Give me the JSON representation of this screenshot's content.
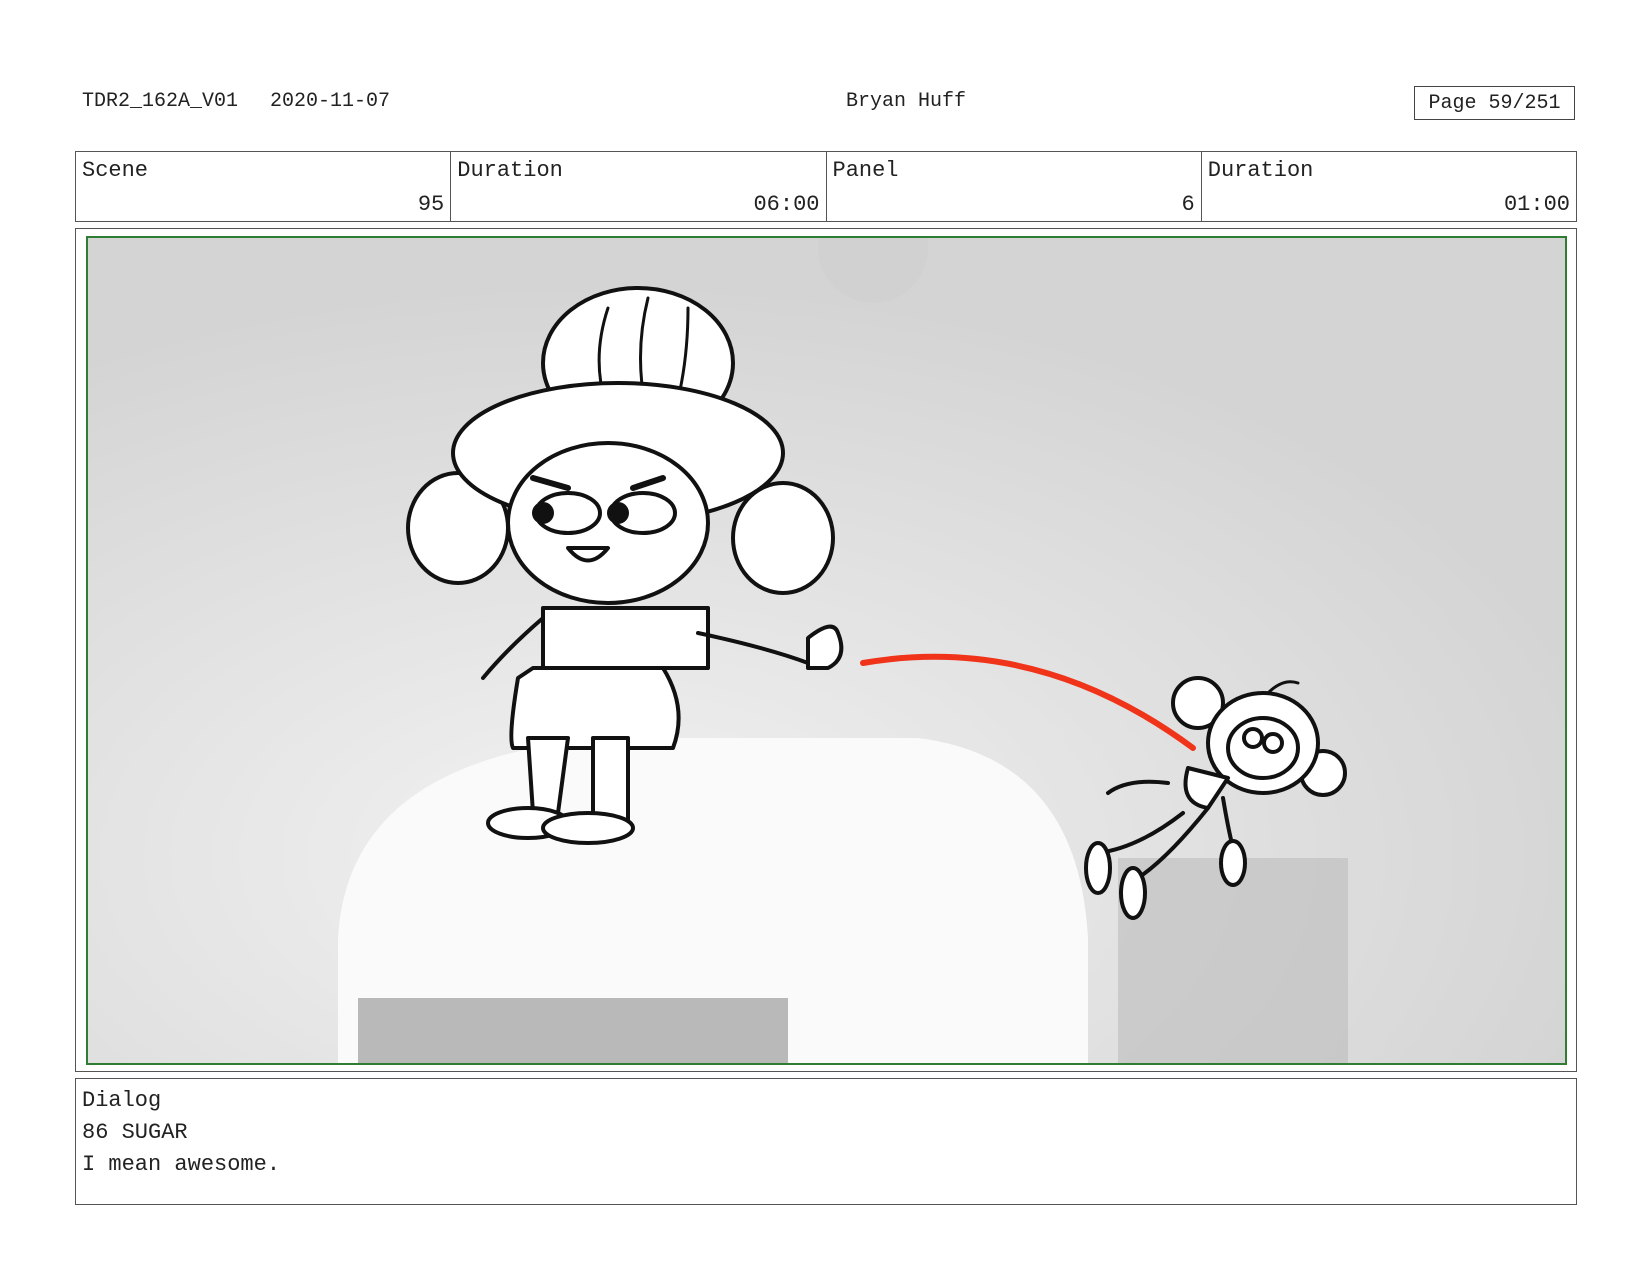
{
  "header": {
    "production_id": "TDR2_162A_V01",
    "date": "2020-11-07",
    "author": "Bryan Huff",
    "page_label": "Page",
    "page_number": "59/251"
  },
  "info": {
    "scene_label": "Scene",
    "scene_value": "95",
    "scene_duration_label": "Duration",
    "scene_duration_value": "06:00",
    "panel_label": "Panel",
    "panel_value": "6",
    "panel_duration_label": "Duration",
    "panel_duration_value": "01:00"
  },
  "dialog": {
    "label": "Dialog",
    "speaker": "86 SUGAR",
    "line": "I mean awesome."
  },
  "colors": {
    "frame_green": "#2e7d32",
    "motion_arc": "#f0341a",
    "background_gray": "#d9d9d9"
  }
}
